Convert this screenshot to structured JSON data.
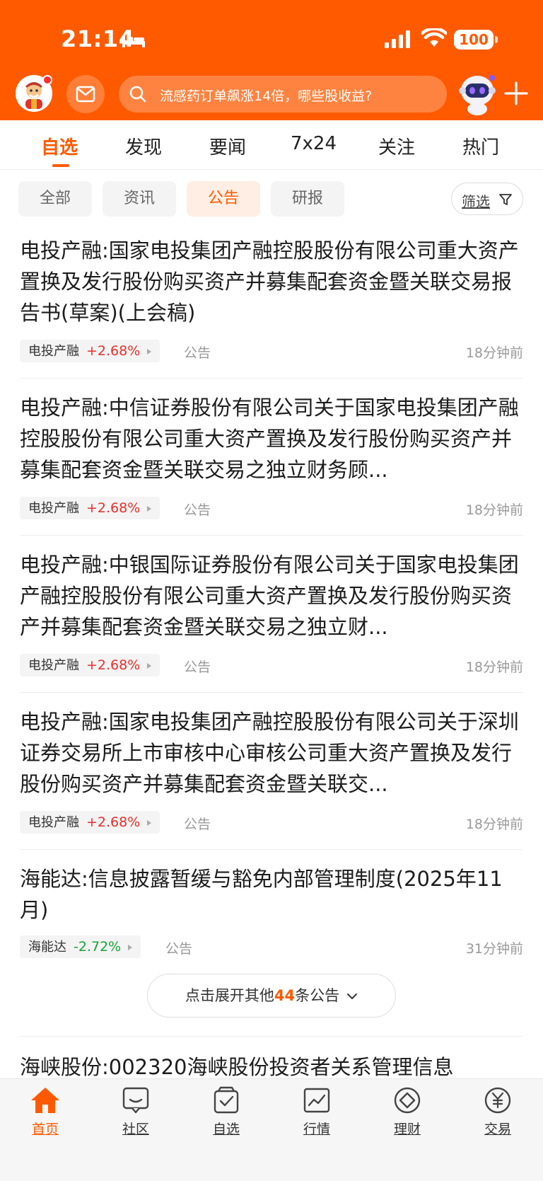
{
  "status_bar": {
    "time": "21:14",
    "battery": "100"
  },
  "search": {
    "placeholder": "流感药订单飙涨14倍，哪些股收益?"
  },
  "tabs": [
    {
      "label": "自选",
      "active": true
    },
    {
      "label": "发现"
    },
    {
      "label": "要闻"
    },
    {
      "label": "7x24"
    },
    {
      "label": "关注"
    },
    {
      "label": "热门"
    }
  ],
  "filters": [
    {
      "label": "全部"
    },
    {
      "label": "资讯"
    },
    {
      "label": "公告",
      "active": true
    },
    {
      "label": "研报"
    }
  ],
  "filter_button": {
    "label": "筛选"
  },
  "news": [
    {
      "title": "电投产融:国家电投集团产融控股股份有限公司重大资产置换及发行股份购买资产并募集配套资金暨关联交易报告书(草案)(上会稿)",
      "stock": "电投产融",
      "change": "+2.68%",
      "direction": "up",
      "type": "公告",
      "time": "18分钟前"
    },
    {
      "title": "电投产融:中信证券股份有限公司关于国家电投集团产融控股股份有限公司重大资产置换及发行股份购买资产并募集配套资金暨关联交易之独立财务顾...",
      "stock": "电投产融",
      "change": "+2.68%",
      "direction": "up",
      "type": "公告",
      "time": "18分钟前"
    },
    {
      "title": "电投产融:中银国际证券股份有限公司关于国家电投集团产融控股股份有限公司重大资产置换及发行股份购买资产并募集配套资金暨关联交易之独立财...",
      "stock": "电投产融",
      "change": "+2.68%",
      "direction": "up",
      "type": "公告",
      "time": "18分钟前"
    },
    {
      "title": "电投产融:国家电投集团产融控股股份有限公司关于深圳证券交易所上市审核中心审核公司重大资产置换及发行股份购买资产并募集配套资金暨关联交...",
      "stock": "电投产融",
      "change": "+2.68%",
      "direction": "up",
      "type": "公告",
      "time": "18分钟前"
    },
    {
      "title": "海能达:信息披露暂缓与豁免内部管理制度(2025年11月)",
      "stock": "海能达",
      "change": "-2.72%",
      "direction": "down",
      "type": "公告",
      "time": "31分钟前"
    }
  ],
  "expand": {
    "prefix": "点击展开其他",
    "count": "44",
    "suffix": "条公告"
  },
  "partial_item": {
    "title": "海峡股份:002320海峡股份投资者关系管理信息"
  },
  "bottom_nav": [
    {
      "label": "首页",
      "icon": "home-icon",
      "active": true
    },
    {
      "label": "社区",
      "icon": "community-icon"
    },
    {
      "label": "自选",
      "icon": "watchlist-icon"
    },
    {
      "label": "行情",
      "icon": "market-icon"
    },
    {
      "label": "理财",
      "icon": "wealth-icon"
    },
    {
      "label": "交易",
      "icon": "trade-icon"
    }
  ],
  "colors": {
    "brand": "#ff5a00",
    "up": "#e8302a",
    "down": "#18a335"
  }
}
